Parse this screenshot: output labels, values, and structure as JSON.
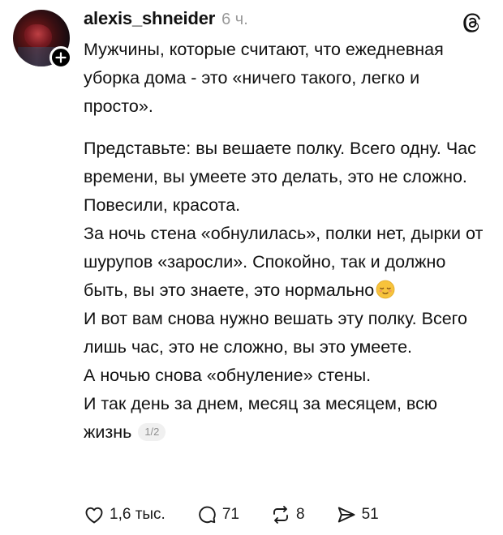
{
  "post": {
    "username": "alexis_shneider",
    "timestamp": "6 ч.",
    "paragraphs": [
      "Мужчины, которые считают, что ежедневная уборка дома - это «ничего такого, легко и просто».",
      "Представьте: вы вешаете полку. Всего одну. Час времени, вы умеете это делать, это не сложно. Повесили, красота.",
      "За ночь стена «обнулилась», полки нет, дырки от шурупов «заросли». Спокойно, так и должно быть, вы это знаете, это нормально",
      "И вот вам снова нужно вешать эту полку. Всего лишь час, это не сложно, вы это умеете.",
      "А ночью снова «обнуление» стены.",
      "И так день за днем, месяц за месяцем, всю жизнь"
    ],
    "page_indicator": "1/2"
  },
  "actions": {
    "likes": "1,6 тыс.",
    "comments": "71",
    "reposts": "8",
    "shares": "51"
  },
  "icons": {
    "avatar": "profile-photo",
    "follow": "plus-icon",
    "app_logo": "threads-logo-icon",
    "like": "heart-icon",
    "comment": "comment-bubble-icon",
    "repost": "repost-arrows-icon",
    "share": "send-paper-plane-icon",
    "emoji": "relieved-face-emoji"
  },
  "colors": {
    "text": "#111111",
    "muted": "#9a9a9a",
    "badge": "#000000",
    "emoji": "#f7c33b"
  }
}
